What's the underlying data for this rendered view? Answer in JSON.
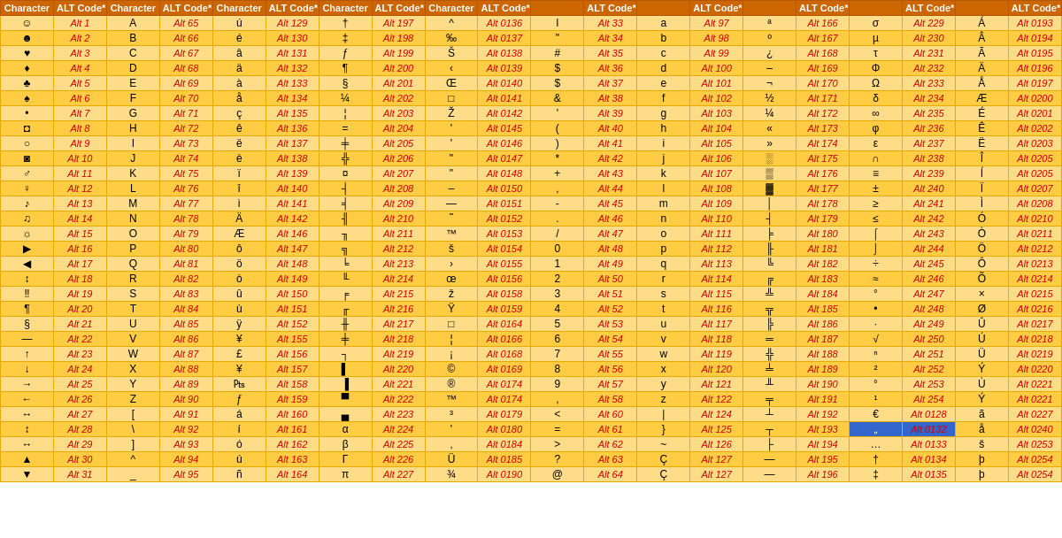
{
  "table": {
    "headers": [
      "Character",
      "ALT Code*",
      "Character",
      "ALT Code*",
      "Character",
      "ALT Code*",
      "Character",
      "ALT Code*",
      "Character",
      "ALT Code*",
      "",
      "ALT Code*",
      "",
      "ALT Code*",
      "",
      "ALT Code*",
      "",
      "ALT Code*",
      "",
      "ALT Code*",
      "",
      "ALT Code*"
    ],
    "rows": [
      [
        "☺",
        "Alt 1",
        "A",
        "Alt 65",
        "ú",
        "Alt 129",
        "†",
        "Alt 197",
        "^",
        "Alt 0136",
        "l",
        "Alt 33",
        "a",
        "Alt 97",
        "ª",
        "Alt 166",
        "σ",
        "Alt 229",
        "Á",
        "Alt 0193"
      ],
      [
        "☻",
        "Alt 2",
        "B",
        "Alt 66",
        "é",
        "Alt 130",
        "‡",
        "Alt 198",
        "‰",
        "Alt 0137",
        "\"",
        "Alt 34",
        "b",
        "Alt 98",
        "º",
        "Alt 167",
        "µ",
        "Alt 230",
        "Â",
        "Alt 0194"
      ],
      [
        "♥",
        "Alt 3",
        "C",
        "Alt 67",
        "â",
        "Alt 131",
        "ƒ",
        "Alt 199",
        "Š",
        "Alt 0138",
        "#",
        "Alt 35",
        "c",
        "Alt 99",
        "¿",
        "Alt 168",
        "τ",
        "Alt 231",
        "Ã",
        "Alt 0195"
      ],
      [
        "♦",
        "Alt 4",
        "D",
        "Alt 68",
        "ä",
        "Alt 132",
        "¶",
        "Alt 200",
        "‹",
        "Alt 0139",
        "$",
        "Alt 36",
        "d",
        "Alt 100",
        "–",
        "Alt 169",
        "Φ",
        "Alt 232",
        "Ä",
        "Alt 0196"
      ],
      [
        "♣",
        "Alt 5",
        "E",
        "Alt 69",
        "à",
        "Alt 133",
        "§",
        "Alt 201",
        "Œ",
        "Alt 0140",
        "$",
        "Alt 37",
        "e",
        "Alt 101",
        "¬",
        "Alt 170",
        "Ω",
        "Alt 233",
        "Å",
        "Alt 0197"
      ],
      [
        "♠",
        "Alt 6",
        "F",
        "Alt 70",
        "å",
        "Alt 134",
        "¼",
        "Alt 202",
        "□",
        "Alt 0141",
        "&",
        "Alt 38",
        "f",
        "Alt 102",
        "½",
        "Alt 171",
        "δ",
        "Alt 234",
        "Æ",
        "Alt 0200"
      ],
      [
        "•",
        "Alt 7",
        "G",
        "Alt 71",
        "ç",
        "Alt 135",
        "¦",
        "Alt 203",
        "Ž",
        "Alt 0142",
        "'",
        "Alt 39",
        "g",
        "Alt 103",
        "¼",
        "Alt 172",
        "∞",
        "Alt 235",
        "É",
        "Alt 0201"
      ],
      [
        "◘",
        "Alt 8",
        "H",
        "Alt 72",
        "ê",
        "Alt 136",
        "=",
        "Alt 204",
        "'",
        "Alt 0145",
        "(",
        "Alt 40",
        "h",
        "Alt 104",
        "«",
        "Alt 173",
        "φ",
        "Alt 236",
        "Ê",
        "Alt 0202"
      ],
      [
        "○",
        "Alt 9",
        "I",
        "Alt 73",
        "ë",
        "Alt 137",
        "╪",
        "Alt 205",
        "'",
        "Alt 0146",
        ")",
        "Alt 41",
        "i",
        "Alt 105",
        "»",
        "Alt 174",
        "ε",
        "Alt 237",
        "Ë",
        "Alt 0203"
      ],
      [
        "◙",
        "Alt 10",
        "J",
        "Alt 74",
        "è",
        "Alt 138",
        "╬",
        "Alt 206",
        "\"",
        "Alt 0147",
        "*",
        "Alt 42",
        "j",
        "Alt 106",
        "░",
        "Alt 175",
        "∩",
        "Alt 238",
        "Î",
        "Alt 0205"
      ],
      [
        "♂",
        "Alt 11",
        "K",
        "Alt 75",
        "ï",
        "Alt 139",
        "¤",
        "Alt 207",
        "\"",
        "Alt 0148",
        "+",
        "Alt 43",
        "k",
        "Alt 107",
        "▒",
        "Alt 176",
        "≡",
        "Alt 239",
        "Í",
        "Alt 0205"
      ],
      [
        "♀",
        "Alt 12",
        "L",
        "Alt 76",
        "î",
        "Alt 140",
        "┤",
        "Alt 208",
        "–",
        "Alt 0150",
        "‚",
        "Alt 44",
        "l",
        "Alt 108",
        "▓",
        "Alt 177",
        "±",
        "Alt 240",
        "Ï",
        "Alt 0207"
      ],
      [
        "♪",
        "Alt 13",
        "M",
        "Alt 77",
        "ì",
        "Alt 141",
        "╡",
        "Alt 209",
        "—",
        "Alt 0151",
        "-",
        "Alt 45",
        "m",
        "Alt 109",
        "│",
        "Alt 178",
        "≥",
        "Alt 241",
        "Ì",
        "Alt 0208"
      ],
      [
        "♫",
        "Alt 14",
        "N",
        "Alt 78",
        "Ä",
        "Alt 142",
        "╢",
        "Alt 210",
        "˜",
        "Alt 0152",
        ".",
        "Alt 46",
        "n",
        "Alt 110",
        "┤",
        "Alt 179",
        "≤",
        "Alt 242",
        "Ó",
        "Alt 0210"
      ],
      [
        "☼",
        "Alt 15",
        "O",
        "Alt 79",
        "Æ",
        "Alt 146",
        "╖",
        "Alt 211",
        "™",
        "Alt 0153",
        "/",
        "Alt 47",
        "o",
        "Alt 111",
        "╞",
        "Alt 180",
        "⌠",
        "Alt 243",
        "Ò",
        "Alt 0211"
      ],
      [
        "▶",
        "Alt 16",
        "P",
        "Alt 80",
        "ô",
        "Alt 147",
        "╗",
        "Alt 212",
        "š",
        "Alt 0154",
        "0",
        "Alt 48",
        "p",
        "Alt 112",
        "╟",
        "Alt 181",
        "⌡",
        "Alt 244",
        "Ö",
        "Alt 0212"
      ],
      [
        "◀",
        "Alt 17",
        "Q",
        "Alt 81",
        "ö",
        "Alt 148",
        "╘",
        "Alt 213",
        "›",
        "Alt 0155",
        "1",
        "Alt 49",
        "q",
        "Alt 113",
        "╚",
        "Alt 182",
        "÷",
        "Alt 245",
        "Ô",
        "Alt 0213"
      ],
      [
        "↕",
        "Alt 18",
        "R",
        "Alt 82",
        "ò",
        "Alt 149",
        "╙",
        "Alt 214",
        "œ",
        "Alt 0156",
        "2",
        "Alt 50",
        "r",
        "Alt 114",
        "╔",
        "Alt 183",
        "≈",
        "Alt 246",
        "Õ",
        "Alt 0214"
      ],
      [
        "‼",
        "Alt 19",
        "S",
        "Alt 83",
        "û",
        "Alt 150",
        "╒",
        "Alt 215",
        "ž",
        "Alt 0158",
        "3",
        "Alt 51",
        "s",
        "Alt 115",
        "╩",
        "Alt 184",
        "°",
        "Alt 247",
        "×",
        "Alt 0215"
      ],
      [
        "¶",
        "Alt 20",
        "T",
        "Alt 84",
        "ù",
        "Alt 151",
        "╓",
        "Alt 216",
        "Ÿ",
        "Alt 0159",
        "4",
        "Alt 52",
        "t",
        "Alt 116",
        "╦",
        "Alt 185",
        "•",
        "Alt 248",
        "Ø",
        "Alt 0216"
      ],
      [
        "§",
        "Alt 21",
        "U",
        "Alt 85",
        "ÿ",
        "Alt 152",
        "╫",
        "Alt 217",
        "□",
        "Alt 0164",
        "5",
        "Alt 53",
        "u",
        "Alt 117",
        "╠",
        "Alt 186",
        "·",
        "Alt 249",
        "Û",
        "Alt 0217"
      ],
      [
        "—",
        "Alt 22",
        "V",
        "Alt 86",
        "¥",
        "Alt 155",
        "╪",
        "Alt 218",
        "¦",
        "Alt 0166",
        "6",
        "Alt 54",
        "v",
        "Alt 118",
        "═",
        "Alt 187",
        "√",
        "Alt 250",
        "Ú",
        "Alt 0218"
      ],
      [
        "↑",
        "Alt 23",
        "W",
        "Alt 87",
        "£",
        "Alt 156",
        "┐",
        "Alt 219",
        "¡",
        "Alt 0168",
        "7",
        "Alt 55",
        "w",
        "Alt 119",
        "╬",
        "Alt 188",
        "ⁿ",
        "Alt 251",
        "Ü",
        "Alt 0219"
      ],
      [
        "↓",
        "Alt 24",
        "X",
        "Alt 88",
        "¥",
        "Alt 157",
        "▌",
        "Alt 220",
        "©",
        "Alt 0169",
        "8",
        "Alt 56",
        "x",
        "Alt 120",
        "╧",
        "Alt 189",
        "²",
        "Alt 252",
        "Ý",
        "Alt 0220"
      ],
      [
        "→",
        "Alt 25",
        "Y",
        "Alt 89",
        "₧",
        "Alt 158",
        "▐",
        "Alt 221",
        "®",
        "Alt 0174",
        "9",
        "Alt 57",
        "y",
        "Alt 121",
        "╨",
        "Alt 190",
        "°",
        "Alt 253",
        "Ù",
        "Alt 0221"
      ],
      [
        "←",
        "Alt 26",
        "Z",
        "Alt 90",
        "ƒ",
        "Alt 159",
        "▀",
        "Alt 222",
        "™",
        "Alt 0174",
        ",",
        "Alt 58",
        "z",
        "Alt 122",
        "╤",
        "Alt 191",
        "¹",
        "Alt 254",
        "Ý",
        "Alt 0221"
      ],
      [
        "↔",
        "Alt 27",
        "[",
        "Alt 91",
        "á",
        "Alt 160",
        "▄",
        "Alt 223",
        "³",
        "Alt 0179",
        "<",
        "Alt 60",
        "|",
        "Alt 124",
        "┴",
        "Alt 192",
        "€",
        "Alt 0128",
        "ã",
        "Alt 0227"
      ],
      [
        "↕",
        "Alt 28",
        "\\",
        "Alt 92",
        "í",
        "Alt 161",
        "α",
        "Alt 224",
        "'",
        "Alt 0180",
        "=",
        "Alt 61",
        "}",
        "Alt 125",
        "┬",
        "Alt 193",
        "„",
        "Alt 0132",
        "å",
        "Alt 0240"
      ],
      [
        "↔",
        "Alt 29",
        "]",
        "Alt 93",
        "ó",
        "Alt 162",
        "β",
        "Alt 225",
        "‚",
        "Alt 0184",
        ">",
        "Alt 62",
        "~",
        "Alt 126",
        "├",
        "Alt 194",
        "…",
        "Alt 0133",
        "š",
        "Alt 0253"
      ],
      [
        "▲",
        "Alt 30",
        "^",
        "Alt 94",
        "ú",
        "Alt 163",
        "Γ",
        "Alt 226",
        "Ü",
        "Alt 0185",
        "?",
        "Alt 63",
        "Ç",
        "Alt 127",
        "—",
        "Alt 195",
        "†",
        "Alt 0134",
        "þ",
        "Alt 0254"
      ],
      [
        "▼",
        "Alt 31",
        "_",
        "Alt 95",
        "ñ",
        "Alt 164",
        "π",
        "Alt 227",
        "¾",
        "Alt 0190",
        "@",
        "Alt 64",
        "Ç",
        "Alt 127",
        "—",
        "Alt 196",
        "‡",
        "Alt 0135",
        "þ",
        "Alt 0254"
      ]
    ]
  }
}
